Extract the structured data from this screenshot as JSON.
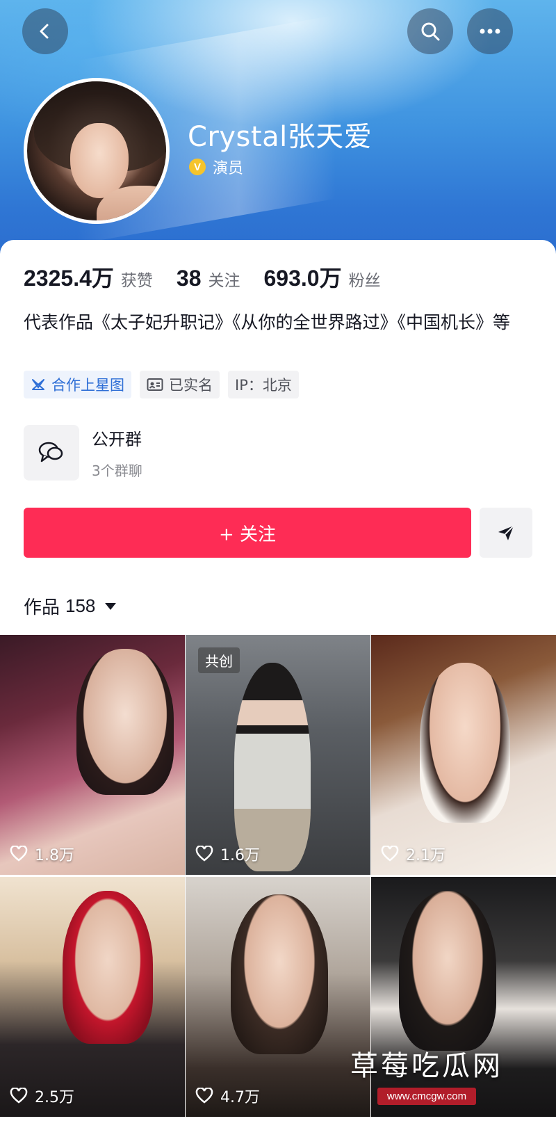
{
  "header": {
    "name": "Crystal张天爱",
    "verified_mark": "V",
    "verified_label": "演员"
  },
  "stats": {
    "likes_value": "2325.4万",
    "likes_label": "获赞",
    "following_value": "38",
    "following_label": "关注",
    "followers_value": "693.0万",
    "followers_label": "粉丝"
  },
  "bio": {
    "text": "代表作品《太子妃升职记》《从你的全世界路过》《中国机长》等"
  },
  "tags": [
    {
      "label": "合作上星图",
      "icon": "star-map-icon"
    },
    {
      "label": "已实名",
      "icon": "id-card-icon"
    },
    {
      "label": "IP：北京",
      "icon": ""
    }
  ],
  "group": {
    "title": "公开群",
    "subtitle": "3个群聊"
  },
  "actions": {
    "follow_label": "+ 关注"
  },
  "works": {
    "title": "作品",
    "count": "158"
  },
  "videos": [
    {
      "likes": "1.8万",
      "badge": ""
    },
    {
      "likes": "1.6万",
      "badge": "共创"
    },
    {
      "likes": "2.1万",
      "badge": ""
    },
    {
      "likes": "2.5万",
      "badge": ""
    },
    {
      "likes": "4.7万",
      "badge": ""
    },
    {
      "likes": "",
      "badge": ""
    }
  ],
  "watermark": {
    "title": "草莓吃瓜网",
    "url": "www.cmcgw.com"
  },
  "colors": {
    "accent": "#fe2c55",
    "banner_blue": "#3f93e0",
    "verified_gold": "#f5c42c"
  }
}
